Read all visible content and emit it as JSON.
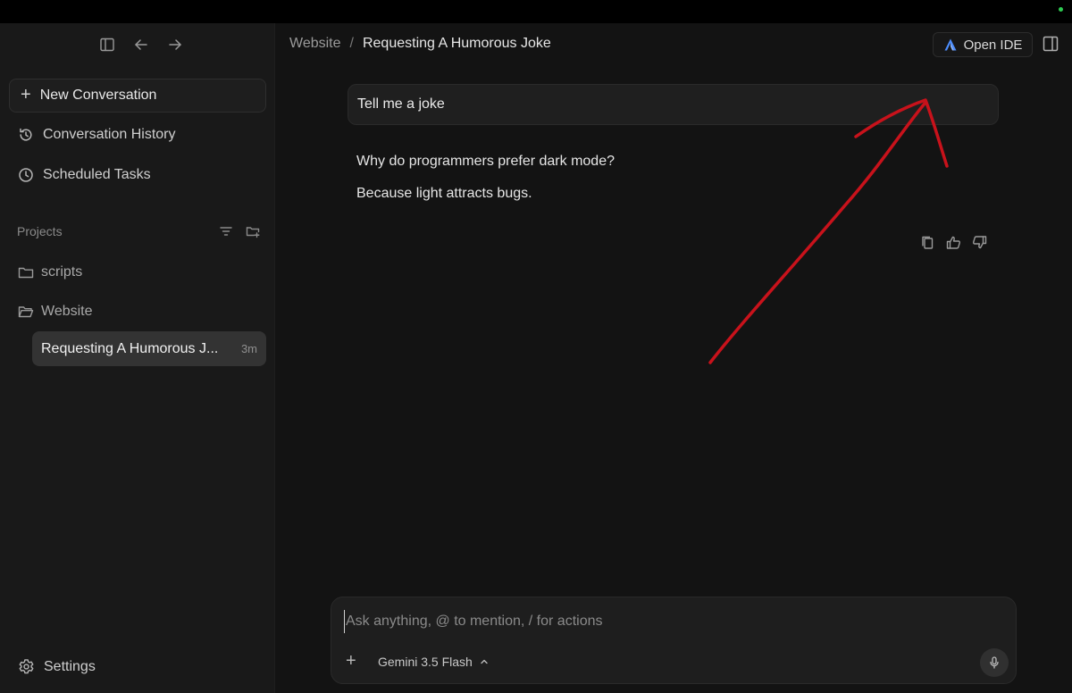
{
  "sidebar": {
    "new_conversation": "New Conversation",
    "nav": [
      {
        "label": "Conversation History",
        "icon": "history-icon"
      },
      {
        "label": "Scheduled Tasks",
        "icon": "clock-icon"
      }
    ],
    "projects_label": "Projects",
    "folders": [
      {
        "label": "scripts",
        "icon": "folder-icon"
      },
      {
        "label": "Website",
        "icon": "folder-open-icon"
      }
    ],
    "active_conversation": {
      "title": "Requesting A Humorous J...",
      "time": "3m"
    },
    "settings_label": "Settings"
  },
  "header": {
    "breadcrumb": [
      "Website",
      "Requesting A Humorous Joke"
    ],
    "separator": "/",
    "open_ide_label": "Open IDE"
  },
  "chat": {
    "user_message": "Tell me a joke",
    "reply_lines": [
      "Why do programmers prefer dark mode?",
      "Because light attracts bugs."
    ]
  },
  "composer": {
    "placeholder": "Ask anything, @ to mention, / for actions",
    "plus": "+",
    "model": "Gemini 3.5 Flash"
  },
  "colors": {
    "annotation_arrow": "#c8121b",
    "status_dot": "#2ecc52",
    "ide_logo_blue": "#4c8dff"
  }
}
